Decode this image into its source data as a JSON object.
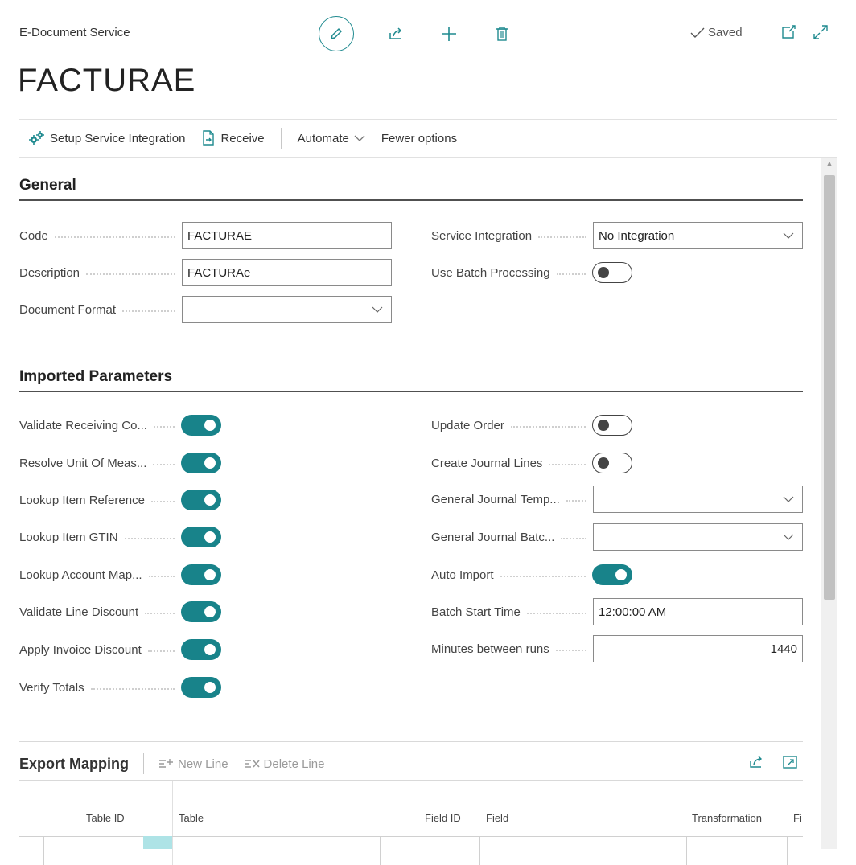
{
  "header": {
    "breadcrumb": "E-Document Service",
    "title": "FACTURAE",
    "saved": "Saved"
  },
  "actionbar": {
    "setup": "Setup Service Integration",
    "receive": "Receive",
    "automate": "Automate",
    "fewer": "Fewer options"
  },
  "general": {
    "title": "General",
    "code_label": "Code",
    "code_value": "FACTURAE",
    "description_label": "Description",
    "description_value": "FACTURAe",
    "document_format_label": "Document Format",
    "document_format_value": "",
    "service_integration_label": "Service Integration",
    "service_integration_value": "No Integration",
    "use_batch_label": "Use Batch Processing",
    "use_batch_value": false
  },
  "imported": {
    "title": "Imported Parameters",
    "left": [
      {
        "label": "Validate Receiving Co...",
        "on": true
      },
      {
        "label": "Resolve Unit Of Meas...",
        "on": true
      },
      {
        "label": "Lookup Item Reference",
        "on": true
      },
      {
        "label": "Lookup Item GTIN",
        "on": true
      },
      {
        "label": "Lookup Account Map...",
        "on": true
      },
      {
        "label": "Validate Line Discount",
        "on": true
      },
      {
        "label": "Apply Invoice Discount",
        "on": true
      },
      {
        "label": "Verify Totals",
        "on": true
      }
    ],
    "update_order_label": "Update Order",
    "create_journal_label": "Create Journal Lines",
    "gen_journal_template_label": "General Journal Temp...",
    "gen_journal_template_value": "",
    "gen_journal_batch_label": "General Journal Batc...",
    "gen_journal_batch_value": "",
    "auto_import_label": "Auto Import",
    "batch_start_label": "Batch Start Time",
    "batch_start_value": "12:00:00 AM",
    "minutes_label": "Minutes between runs",
    "minutes_value": "1440"
  },
  "export_mapping": {
    "title": "Export Mapping",
    "new_line": "New Line",
    "delete_line": "Delete Line",
    "columns": [
      "Table ID",
      "Table",
      "Field ID",
      "Field",
      "Transformation",
      "Fi"
    ]
  }
}
